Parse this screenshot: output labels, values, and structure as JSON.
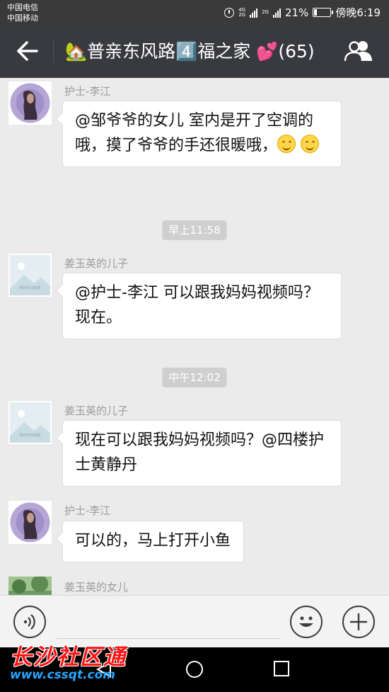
{
  "status_bar": {
    "carrier_1": "中国电信",
    "carrier_2": "中国移动",
    "battery": "21%",
    "battery_level": 0.21,
    "clock": "傍晚6:19"
  },
  "header": {
    "title": "🏡普亲东风路4️⃣福之家 💕(65)"
  },
  "messages": [
    {
      "sender": "护士-李江",
      "text": "@邹爷爷的女儿 室内是开了空调的哦，摸了爷爷的手还很暖哦，",
      "emoji_count": 2
    },
    {
      "time": "早上11:58"
    },
    {
      "sender": "姜玉英的儿子",
      "text": "@护士-李江 可以跟我妈妈视频吗？现在。"
    },
    {
      "time": "中午12:02"
    },
    {
      "sender": "姜玉英的儿子",
      "text": "现在可以跟我妈妈视频吗？@四楼护士黄静丹"
    },
    {
      "sender": "护士-李江",
      "text": "可以的，马上打开小鱼"
    },
    {
      "sender": "姜玉英的女儿"
    }
  ],
  "image_placeholder_text": "暂时无法查看",
  "watermark": {
    "line1": "长沙社区通",
    "line2": "www.cssqt.com"
  },
  "colors": {
    "header_bg": "#393a3f",
    "chat_bg": "#ebebeb",
    "bubble_bg": "#ffffff",
    "watermark_red": "#ff1414",
    "watermark_blue": "#27a6ff"
  }
}
